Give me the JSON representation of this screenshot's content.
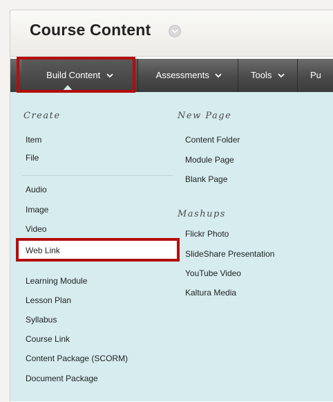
{
  "header": {
    "title": "Course Content"
  },
  "navbar": {
    "build_content": "Build Content",
    "assessments": "Assessments",
    "tools": "Tools",
    "more": "Pu"
  },
  "menu": {
    "create_heading": "Create",
    "create_items_a": [
      "Item",
      "File"
    ],
    "create_items_b": [
      "Audio",
      "Image",
      "Video"
    ],
    "web_link": "Web Link",
    "create_items_c": [
      "Learning Module",
      "Lesson Plan",
      "Syllabus",
      "Course Link",
      "Content Package (SCORM)",
      "Document Package"
    ],
    "new_page_heading": "New Page",
    "new_page_items": [
      "Content Folder",
      "Module Page",
      "Blank Page"
    ],
    "mashups_heading": "Mashups",
    "mashups_items": [
      "Flickr Photo",
      "SlideShare Presentation",
      "YouTube Video",
      "Kaltura Media"
    ]
  },
  "colors": {
    "highlight": "#b50d0d",
    "menu_bg": "#d6ecef",
    "nav_bg": "#4a4a4a"
  }
}
